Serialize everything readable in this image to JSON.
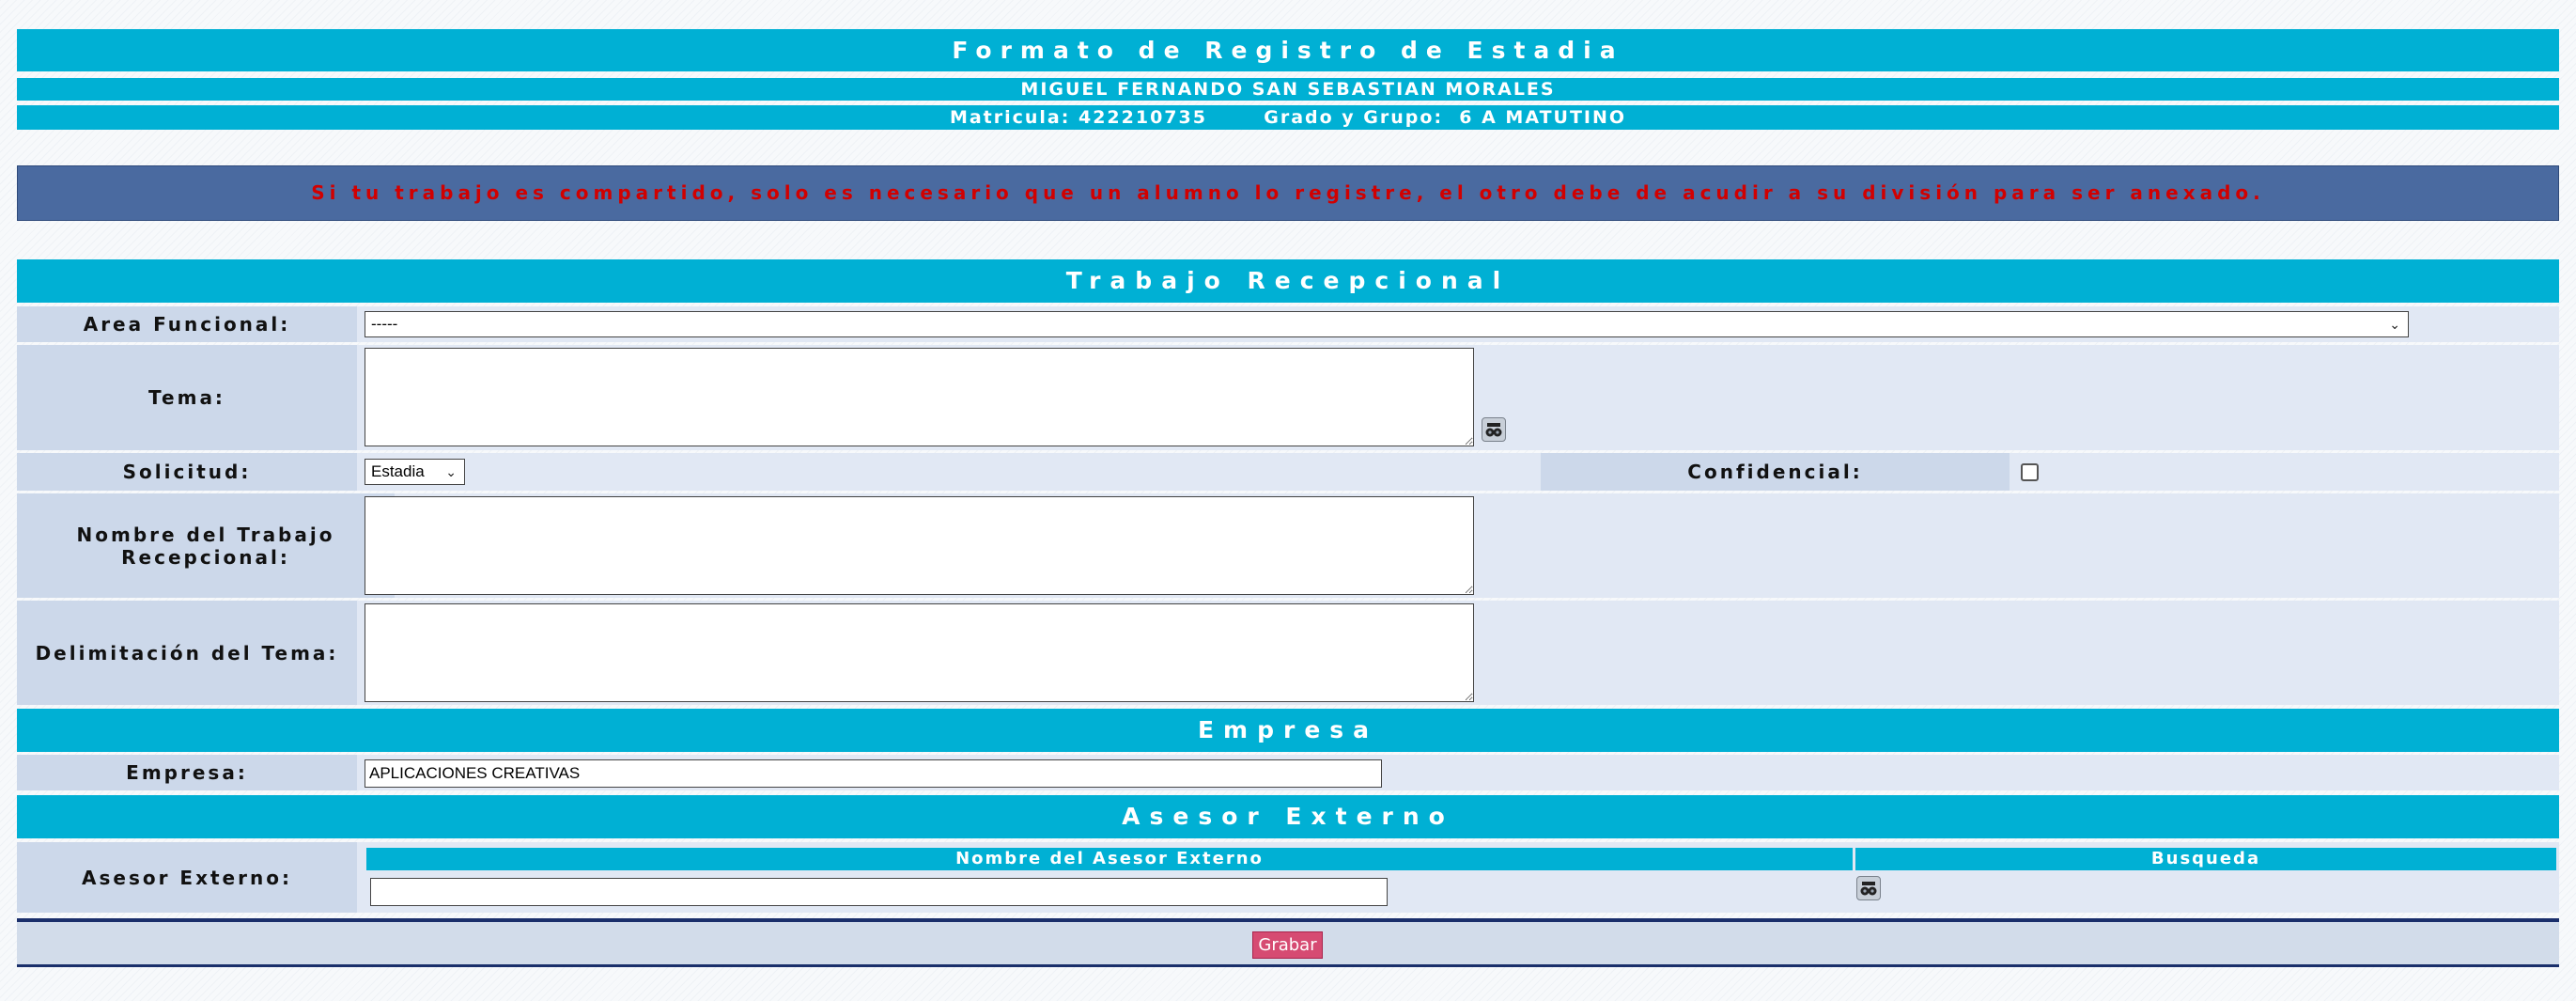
{
  "header": {
    "title": "Formato de Registro de Estadia",
    "student_name": "MIGUEL FERNANDO SAN SEBASTIAN MORALES",
    "matricula_line": "Matricula: 422210735       Grado y Grupo:  6 A MATUTINO"
  },
  "notice": "Si tu trabajo es compartido, solo es necesario que un alumno lo registre, el otro debe de acudir a su división para ser anexado.",
  "trabajo": {
    "section_title": "Trabajo Recepcional",
    "area_label": "Area Funcional:",
    "area_value": "-----",
    "tema_label": "Tema:",
    "tema_value": "",
    "solicitud_label": "Solicitud:",
    "solicitud_value": "Estadia",
    "confidencial_label": "Confidencial:",
    "confidencial_checked": false,
    "nombre_label": "Nombre del Trabajo Recepcional:",
    "nombre_value": "",
    "delimitacion_label": "Delimitación del Tema:",
    "delimitacion_value": ""
  },
  "empresa": {
    "section_title": "Empresa",
    "label": "Empresa:",
    "value": "APLICACIONES CREATIVAS"
  },
  "asesor": {
    "section_title": "Asesor Externo",
    "label": "Asesor Externo:",
    "col_nombre": "Nombre del Asesor Externo",
    "col_busqueda": "Busqueda",
    "nombre_value": ""
  },
  "actions": {
    "save_label": "Grabar"
  },
  "icons": {
    "search": "binoculars-icon",
    "dropdown": "chevron-down-icon"
  },
  "colors": {
    "header_bar": "#00b0d4",
    "notice_bg": "#4a6aa0",
    "notice_text": "#d10000",
    "label_bg": "#ccd8ea",
    "row_bg": "#e1e8f4",
    "save_button": "#d64b72"
  }
}
